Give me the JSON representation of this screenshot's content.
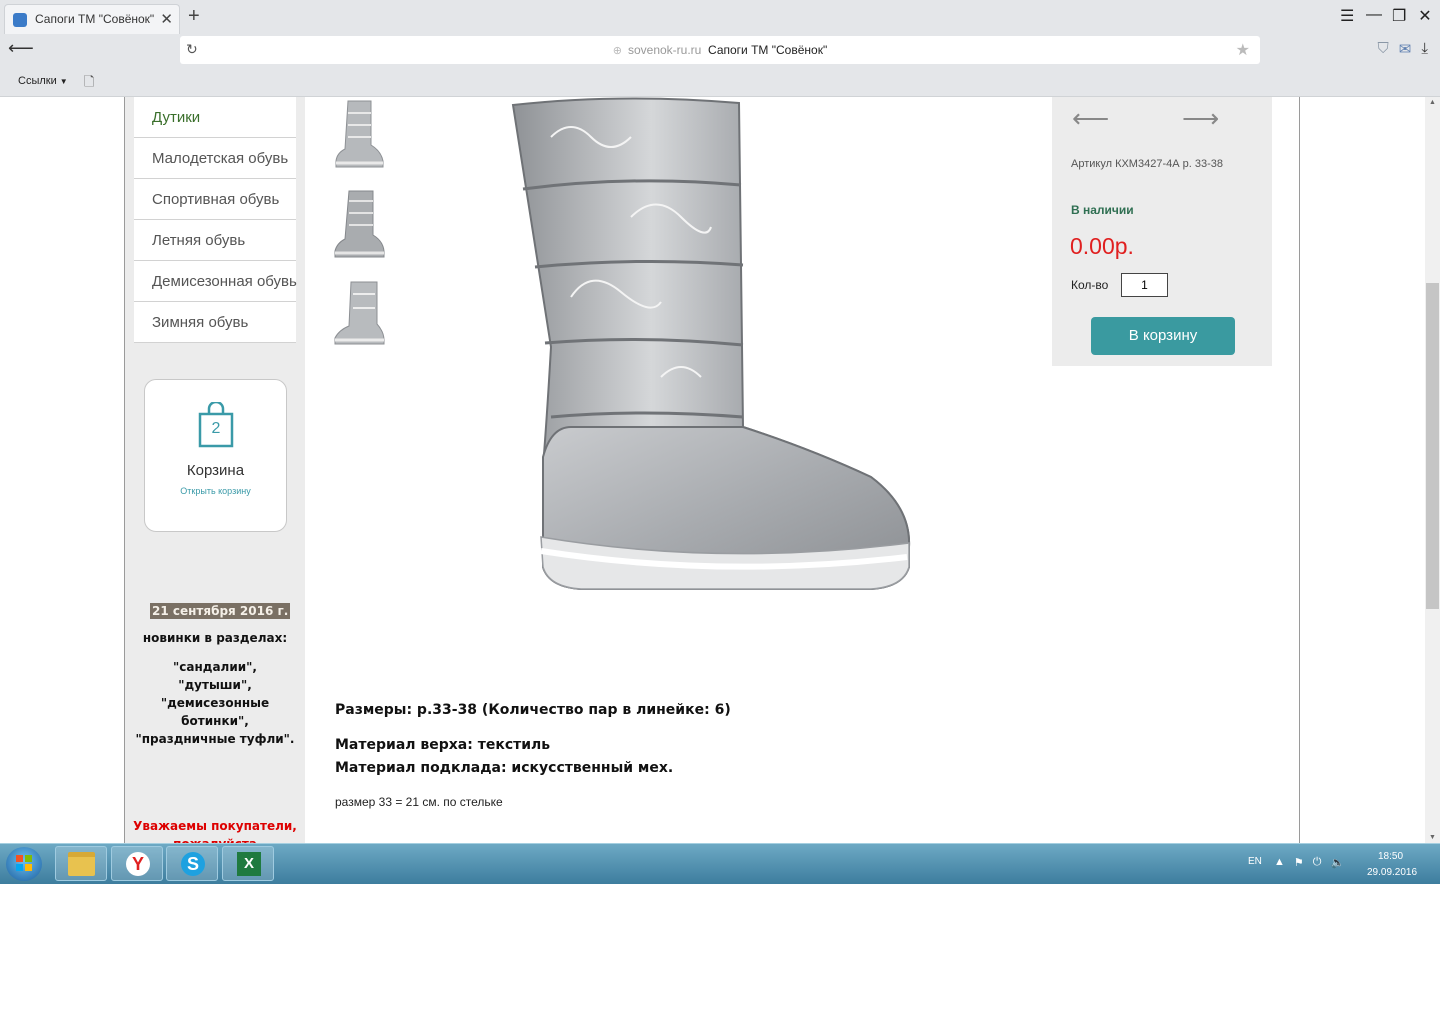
{
  "browser": {
    "tab_title": "Сапоги ТМ \"Совёнок\"",
    "tab_close": "✕",
    "new_tab": "+",
    "url_domain": "sovenok-ru.ru",
    "url_title": "Сапоги ТМ \"Совёнок\"",
    "bookmarks_label": "Ссылки",
    "window_controls": [
      "☰",
      "—",
      "❐",
      "✕"
    ]
  },
  "categories": [
    "Дутики",
    "Малодетская обувь",
    "Спортивная обувь",
    "Летняя обувь",
    "Демисезонная обувь",
    "Зимняя обувь"
  ],
  "cart": {
    "count": "2",
    "title": "Корзина",
    "open_link": "Открыть корзину"
  },
  "news": {
    "date": "21 сентября 2016 г.",
    "heading": "новинки в разделах:",
    "sections": "\"сандалии\", \"дутыши\", \"демисезонные ботинки\", \"праздничные туфли\"."
  },
  "notice": {
    "line1": "Уважаемы покупатели,",
    "line2": "пожалуйста"
  },
  "product": {
    "prev_arrow": "⟵",
    "next_arrow": "⟶",
    "article": "Артикул КХМ3427-4А р. 33-38",
    "stock": "В наличии",
    "price": "0.00р.",
    "qty_label": "Кол-во",
    "qty_value": "1",
    "add_to_cart": "В корзину",
    "sizes": "Размеры: р.33-38 (Количество пар в линейке: 6)",
    "material_upper": "Материал верха: текстиль",
    "material_lining": "Материал подклада: искусственный мех.",
    "size_note": "размер 33 = 21 см. по стельке"
  },
  "taskbar": {
    "lang": "EN",
    "time": "18:50",
    "date": "29.09.2016"
  },
  "colors": {
    "accent": "#3a9aa0",
    "price": "#e02020",
    "stock": "#2f6f52",
    "notice": "#dd0000"
  }
}
